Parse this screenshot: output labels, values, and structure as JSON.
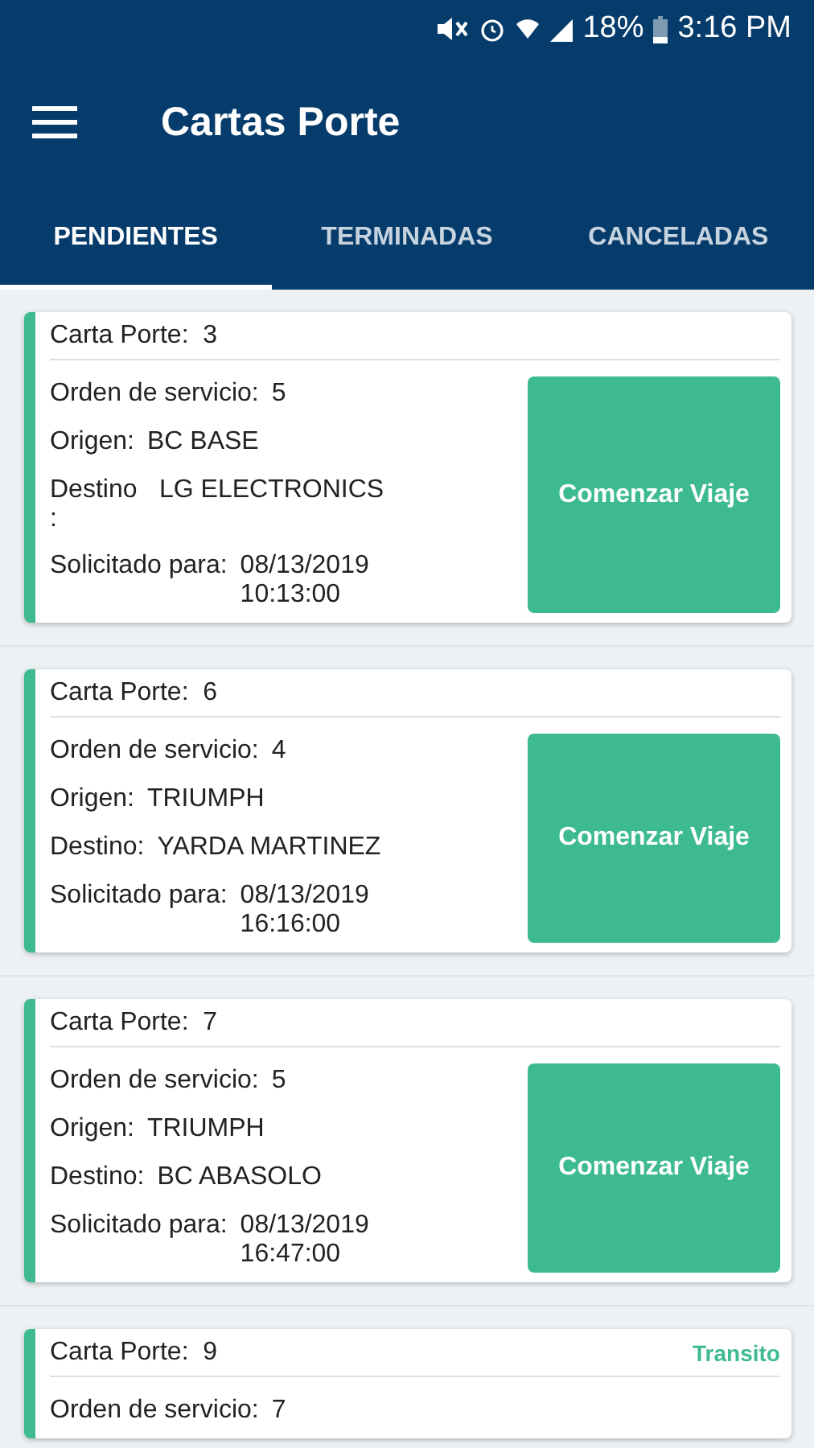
{
  "status_bar": {
    "battery": "18%",
    "time": "3:16 PM"
  },
  "app_bar": {
    "title": "Cartas Porte"
  },
  "tabs": [
    {
      "label": "PENDIENTES",
      "selected": true
    },
    {
      "label": "TERMINADAS",
      "selected": false
    },
    {
      "label": "CANCELADAS",
      "selected": false
    }
  ],
  "cards": [
    {
      "header_label": "Carta Porte:",
      "header_value": "3",
      "rows": [
        {
          "label": "Orden de servicio:",
          "value": "5"
        },
        {
          "label": "Origen:",
          "value": "BC BASE"
        },
        {
          "label": "Destino :",
          "value": "LG ELECTRONICS",
          "label_wrapped": true
        },
        {
          "label": "Solicitado para:",
          "value": "08/13/2019",
          "value_2": "10:13:00"
        }
      ],
      "button": "Comenzar Viaje"
    },
    {
      "header_label": "Carta Porte:",
      "header_value": "6",
      "rows": [
        {
          "label": "Orden de servicio:",
          "value": "4"
        },
        {
          "label": "Origen:",
          "value": "TRIUMPH"
        },
        {
          "label": "Destino:",
          "value": "YARDA MARTINEZ"
        },
        {
          "label": "Solicitado para:",
          "value": "08/13/2019",
          "value_2": "16:16:00"
        }
      ],
      "button": "Comenzar Viaje"
    },
    {
      "header_label": "Carta Porte:",
      "header_value": "7",
      "rows": [
        {
          "label": "Orden de servicio:",
          "value": "5"
        },
        {
          "label": "Origen:",
          "value": "TRIUMPH"
        },
        {
          "label": "Destino:",
          "value": "BC ABASOLO"
        },
        {
          "label": "Solicitado para:",
          "value": "08/13/2019",
          "value_2": "16:47:00"
        }
      ],
      "button": "Comenzar Viaje"
    },
    {
      "header_label": "Carta Porte:",
      "header_value": "9",
      "status": "Transito",
      "rows": [
        {
          "label": "Orden de servicio:",
          "value": "7"
        }
      ]
    }
  ]
}
